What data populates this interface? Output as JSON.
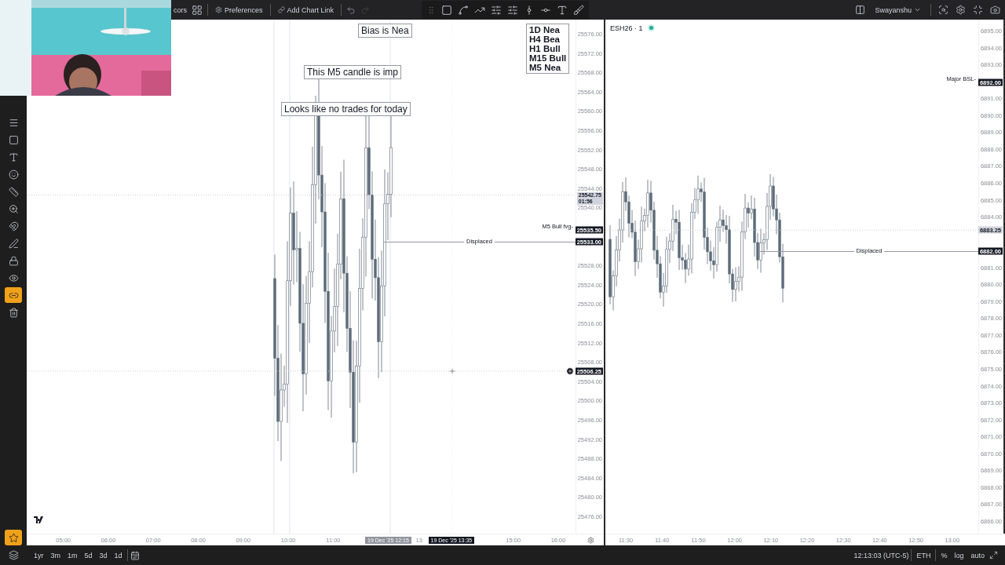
{
  "top_bar": {
    "cut_label": "cors",
    "preferences": "Preferences",
    "chart_link": "Add Chart Link",
    "redo_disabled": true,
    "layout_name": "Swayanshu"
  },
  "left_tools": [
    {
      "kind": "lines",
      "selected": false
    },
    {
      "kind": "rectangle",
      "selected": false
    },
    {
      "kind": "text",
      "selected": false
    },
    {
      "kind": "emoji",
      "selected": false
    },
    {
      "kind": "ruler",
      "selected": false
    },
    {
      "kind": "zoom",
      "selected": false
    },
    {
      "kind": "magnet",
      "selected": false
    },
    {
      "kind": "pen",
      "selected": false
    },
    {
      "kind": "lock",
      "selected": false
    },
    {
      "kind": "eye",
      "selected": false
    },
    {
      "kind": "link",
      "selected": true
    },
    {
      "kind": "trash",
      "selected": false
    }
  ],
  "bottom_tools": [
    {
      "kind": "star",
      "selected": true
    },
    {
      "kind": "layers",
      "selected": false
    }
  ],
  "left_chart": {
    "notes": [
      "Bias is Nea",
      "This M5 candle is imp",
      "Looks like no trades for today"
    ],
    "bias_table": [
      "1D Nea",
      "H4 Bea",
      "H1 Bull",
      "M15 Bull",
      "M5 Nea"
    ],
    "price_axis": [
      "25576.00",
      "25572.00",
      "25568.00",
      "25564.00",
      "25560.00",
      "25556.00",
      "25552.00",
      "25548.00",
      "25544.00",
      "25540.00",
      "25528.00",
      "25524.00",
      "25520.00",
      "25516.00",
      "25512.00",
      "25508.00",
      "25504.00",
      "25500.00",
      "25496.00",
      "25492.00",
      "25488.00",
      "25484.00",
      "25480.00",
      "25476.00"
    ],
    "levels": [
      {
        "label": "M5 Bull fvg-",
        "tag": "25535.50",
        "kind": "right"
      },
      {
        "label": "Displaced",
        "tag": "25533.00",
        "kind": "center"
      }
    ],
    "last_price": {
      "tag": "25542.75",
      "countdown": "01:56"
    },
    "crosshair": {
      "tag": "25506.25"
    },
    "time_axis": {
      "before": [
        "05:00",
        "06:00",
        "07:00",
        "08:00",
        "09:00",
        "10:00",
        "11:00"
      ],
      "after": [
        "15:00",
        "16:00"
      ]
    },
    "time_tags": [
      {
        "text": "19 Dec '25  12:15",
        "kind": "ghost"
      },
      {
        "text": "13:",
        "kind": "cut"
      },
      {
        "text": "19 Dec '25  13:35",
        "kind": "cursor"
      }
    ]
  },
  "right_chart": {
    "symbol": "ESH26 · 1",
    "live": true,
    "price_axis": [
      "6895.00",
      "6894.00",
      "6893.00",
      "6891.00",
      "6890.00",
      "6889.00",
      "6888.00",
      "6887.00",
      "6886.00",
      "6885.00",
      "6884.00",
      "6881.00",
      "6880.00",
      "6879.00",
      "6878.00",
      "6877.00",
      "6876.00",
      "6875.00",
      "6874.00",
      "6873.00",
      "6872.00",
      "6871.00",
      "6870.00",
      "6869.00",
      "6868.00",
      "6867.00",
      "6866.00"
    ],
    "levels": [
      {
        "label": "Major BSL-",
        "tag": "6892.00",
        "kind": "right"
      },
      {
        "label": "Displaced",
        "tag": "6882.00",
        "kind": "center"
      }
    ],
    "last_price": {
      "tag": "6883.25"
    },
    "time_axis": [
      "11:30",
      "11:40",
      "11:50",
      "12:00",
      "12:10",
      "12:20",
      "12:30",
      "12:40",
      "12:50",
      "13:00"
    ]
  },
  "bottom_bar": {
    "ranges": [
      "1yr",
      "3m",
      "1m",
      "5d",
      "3d",
      "1d"
    ],
    "clock": "12:13:03 (UTC-5)",
    "session": "ETH",
    "options": [
      "%",
      "log",
      "auto"
    ]
  }
}
